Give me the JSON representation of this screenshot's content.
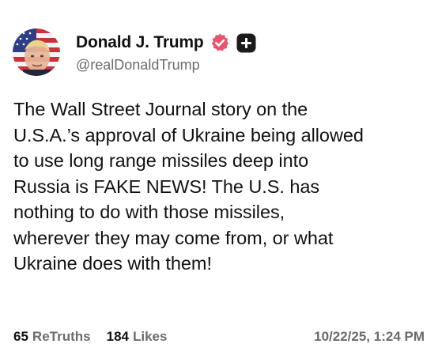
{
  "author": {
    "display_name": "Donald J. Trump",
    "handle": "@realDonaldTrump"
  },
  "post": {
    "lines": [
      "The Wall Street Journal story on the",
      "U.S.A.’s approval of Ukraine being allowed",
      "to use long range missiles deep into",
      "Russia is FAKE NEWS! The U.S. has",
      "nothing to do with those missiles,",
      "wherever they may come from, or what",
      "Ukraine does with them!"
    ]
  },
  "stats": {
    "retruths_count": "65",
    "retruths_label": "ReTruths",
    "likes_count": "184",
    "likes_label": "Likes",
    "timestamp": "10/22/25, 1:24 PM"
  },
  "icons": {
    "verified": "verified-badge-icon",
    "follow": "follow-plus-icon"
  },
  "colors": {
    "verified": "#e9546f",
    "follow_button": "#1b1b1b",
    "muted_text": "#6b6b6b"
  }
}
